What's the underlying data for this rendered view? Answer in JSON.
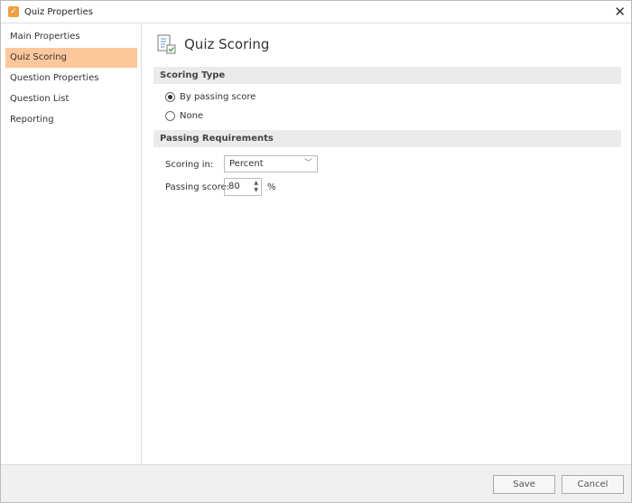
{
  "window": {
    "title": "Quiz Properties",
    "icon": "checkbox-app-icon",
    "accent": "#f0a040"
  },
  "sidebar": {
    "items": [
      {
        "label": "Main Properties"
      },
      {
        "label": "Quiz Scoring",
        "selected": true
      },
      {
        "label": "Question Properties"
      },
      {
        "label": "Question List"
      },
      {
        "label": "Reporting"
      }
    ],
    "selected_color": "#fcc89b"
  },
  "main": {
    "title": "Quiz Scoring",
    "scoring_type": {
      "heading": "Scoring Type",
      "options": [
        {
          "label": "By passing score",
          "checked": true
        },
        {
          "label": "None",
          "checked": false
        }
      ]
    },
    "passing": {
      "heading": "Passing Requirements",
      "scoring_in_label": "Scoring in:",
      "scoring_in_value": "Percent",
      "passing_score_label": "Passing score:",
      "passing_score_value": "80",
      "unit": "%"
    }
  },
  "footer": {
    "save": "Save",
    "cancel": "Cancel"
  }
}
